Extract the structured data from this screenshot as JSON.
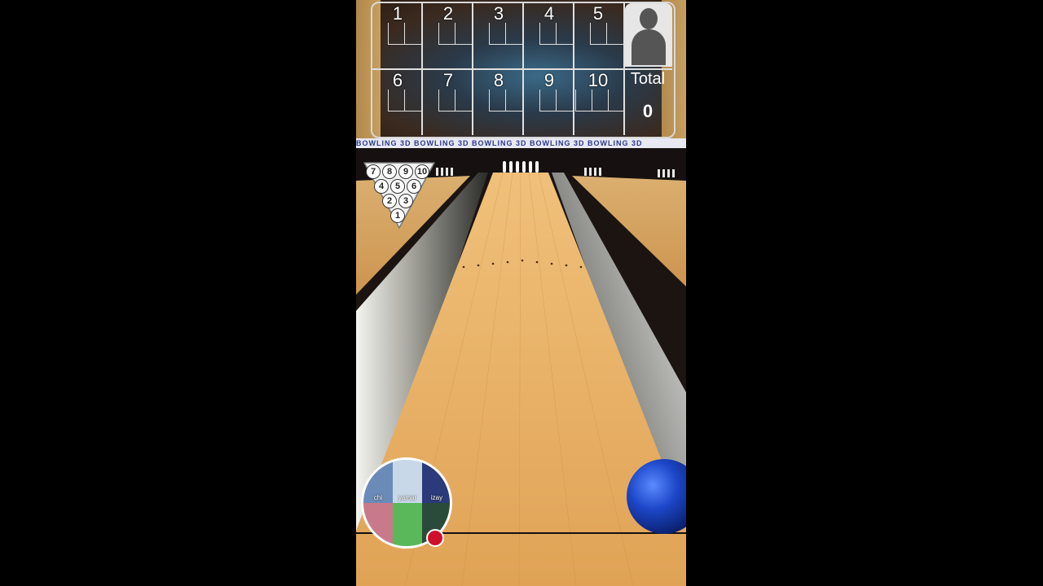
{
  "scoreboard": {
    "frames_top": [
      "1",
      "2",
      "3",
      "4",
      "5"
    ],
    "frames_bottom": [
      "6",
      "7",
      "8",
      "9",
      "10"
    ],
    "total_label": "Total",
    "total_value": "0"
  },
  "banner": {
    "text": "BOWLING 3D BOWLING 3D BOWLING 3D BOWLING 3D BOWLING 3D"
  },
  "pin_indicator": {
    "rows": [
      [
        "7",
        "8",
        "9",
        "10"
      ],
      [
        "4",
        "5",
        "6"
      ],
      [
        "2",
        "3"
      ],
      [
        "1"
      ]
    ]
  },
  "player": {
    "labels": [
      "chi",
      "yamar",
      "izay"
    ]
  },
  "colors": {
    "lane_wood": "#e8b062",
    "gutter": "#3a3a3a",
    "ball": "#1d47c8",
    "record_dot": "#d0102a"
  }
}
